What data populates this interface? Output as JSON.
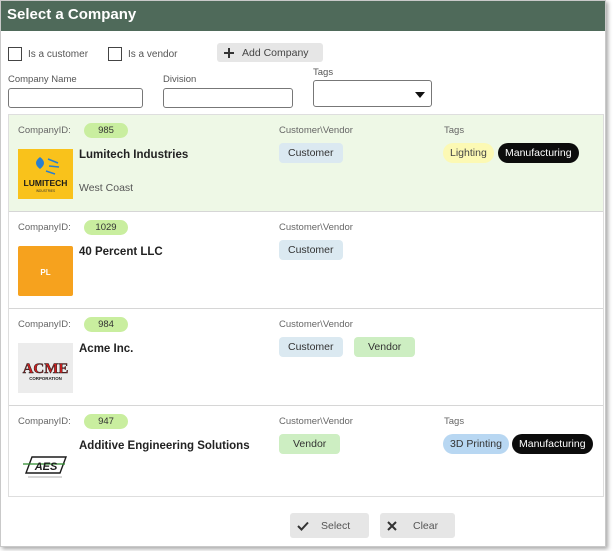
{
  "dialog": {
    "title": "Select a Company"
  },
  "filters": {
    "is_customer_label": "Is a customer",
    "is_vendor_label": "Is a vendor",
    "add_company_label": "Add Company",
    "company_name_label": "Company Name",
    "company_name_value": "",
    "division_label": "Division",
    "division_value": "",
    "tags_label": "Tags",
    "tags_value": ""
  },
  "list_labels": {
    "company_id": "CompanyID:",
    "customer_vendor": "Customer\\Vendor",
    "tags": "Tags"
  },
  "companies": [
    {
      "id": "985",
      "name": "Lumitech Industries",
      "division": "West Coast",
      "logo_text": "LUMITECH",
      "logo_subtext": "INDUSTRIES",
      "types": [
        "Customer"
      ],
      "tags": [
        "Lighting",
        "Manufacturing"
      ],
      "selected": true
    },
    {
      "id": "1029",
      "name": "40 Percent LLC",
      "division": "",
      "logo_text": "PL",
      "types": [
        "Customer"
      ],
      "tags": []
    },
    {
      "id": "984",
      "name": "Acme Inc.",
      "division": "",
      "logo_text": "ACME",
      "logo_subtext": "CORPORATION",
      "types": [
        "Customer",
        "Vendor"
      ],
      "tags": []
    },
    {
      "id": "947",
      "name": "Additive Engineering Solutions",
      "division": "",
      "logo_text": "AES",
      "types": [
        "Vendor"
      ],
      "tags": [
        "3D Printing",
        "Manufacturing"
      ]
    }
  ],
  "footer": {
    "select_label": "Select",
    "clear_label": "Clear"
  },
  "colors": {
    "title_bar": "#4f6a5a",
    "selected_row": "#eef8e6",
    "id_pill": "#c9ee9f",
    "customer_badge": "#dbe9f1",
    "vendor_badge": "#cdeec2",
    "tag_lighting": "#fcf9b4",
    "tag_manufacturing": "#0c0c0c",
    "tag_3d_printing": "#b8d7f2"
  }
}
